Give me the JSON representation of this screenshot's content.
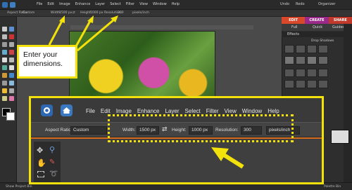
{
  "topbar": {
    "menu": [
      "File",
      "Edit",
      "Image",
      "Enhance",
      "Layer",
      "Select",
      "Filter",
      "View",
      "Window",
      "Help"
    ],
    "undo": "Undo",
    "redo": "Redo",
    "organizer": "Organizer"
  },
  "top_options": {
    "aspect_ratio_label": "Aspect Ratio:",
    "aspect_ratio_value": "Custom",
    "width_label": "Width:",
    "width_value": "1500 px",
    "height_label": "Height:",
    "height_value": "1000 px",
    "resolution_label": "Resolution:",
    "resolution_value": "300",
    "units": "pixels/inch"
  },
  "right_panel": {
    "tabs": [
      {
        "label": "EDIT",
        "color": "#d9482b"
      },
      {
        "label": "CREATE",
        "color": "#9a2a8a"
      },
      {
        "label": "SHARE",
        "color": "#c0392b"
      }
    ],
    "modes": [
      "Full",
      "Quick",
      "Guided"
    ],
    "effects_header": "Effects",
    "dropdown": "Drop Shadows"
  },
  "callout": {
    "text": "Enter your dimensions."
  },
  "zoom": {
    "menu": [
      "File",
      "Edit",
      "Image",
      "Enhance",
      "Layer",
      "Select",
      "Filter",
      "View",
      "Window",
      "Help"
    ],
    "aspect_ratio_label": "Aspect Ratio:",
    "aspect_ratio_value": "Custom",
    "width_label": "Width:",
    "width_value": "1500 px",
    "height_label": "Height:",
    "height_value": "1000 px",
    "resolution_label": "Resolution:",
    "resolution_value": "300",
    "units": "pixels/inch"
  },
  "bottom": {
    "left": "Show Project Bin",
    "right": "Palette Bin"
  },
  "colors": {
    "highlight": "#f2e10a",
    "accent_orange": "#d46a1a"
  }
}
